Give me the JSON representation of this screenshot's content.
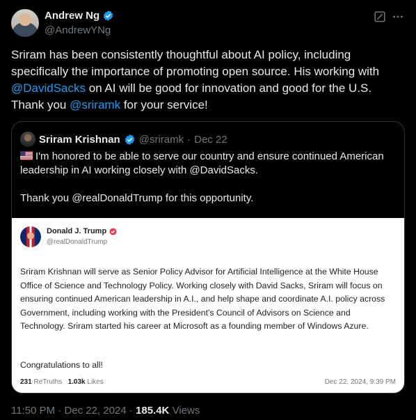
{
  "author": {
    "name": "Andrew Ng",
    "handle": "@AndrewYNg"
  },
  "tweet": {
    "part1": "Sriram has been consistently thoughtful about AI policy, including specifically the importance of promoting open source. His working with ",
    "mention1": "@DavidSacks",
    "part2": " on AI will be good for innovation and good for the U.S. Thank you ",
    "mention2": "@sriramk",
    "part3": " for your service!"
  },
  "quote": {
    "name": "Sriram Krishnan",
    "handle": "@sriramk",
    "sep": "·",
    "date": "Dec 22",
    "line1": "I'm honored to be able to serve our country and ensure continued American leadership in AI working closely with @DavidSacks.",
    "line2": "Thank you @realDonaldTrump for this opportunity.",
    "card": {
      "name": "Donald J. Trump",
      "handle": "@realDonaldTrump",
      "body": "Sriram Krishnan will serve as Senior Policy Advisor for Artificial Intelligence at the White House Office of Science and Technology Policy. Working closely with David Sacks, Sriram will focus on ensuring continued American leadership in A.I., and help shape and coordinate A.I. policy across Government, including working with the President's Council of Advisors on Science and Technology. Sriram started his career at Microsoft as a founding member of Windows Azure.",
      "congrats": "Congratulations to all!",
      "retruths_count": "231",
      "retruths_label": "ReTruths",
      "likes_count": "1.03k",
      "likes_label": "Likes",
      "date": "Dec 22, 2024, 9:39 PM"
    }
  },
  "meta": {
    "time": "11:50 PM",
    "sep": "·",
    "date": "Dec 22, 2024",
    "views_count": "185.4K",
    "views_label": "Views"
  },
  "colors": {
    "accent": "#1d9bf0",
    "verified": "#1d9bf0",
    "truth_badge": "#e0465b",
    "background": "#000000",
    "card_background": "#ffffff"
  },
  "icons": [
    "verified-badge-icon",
    "grok-icon",
    "more-icon",
    "us-flag-icon"
  ]
}
